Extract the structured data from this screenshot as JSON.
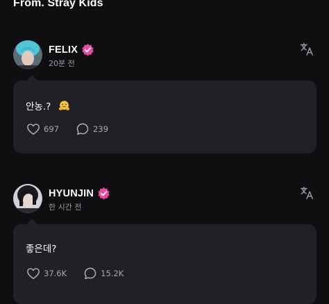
{
  "header": {
    "title": "From. Stray Kids"
  },
  "colors": {
    "background": "#0f0f11",
    "bubble": "#202026",
    "verified": "#e94aa0",
    "muted": "#9a9aa2"
  },
  "posts": [
    {
      "author": "FELIX",
      "verified_icon": "verified-badge-icon",
      "time": "20분 전",
      "message": "안농.?",
      "emoji": "hugging-face-emoji",
      "likes": "697",
      "comments": "239"
    },
    {
      "author": "HYUNJIN",
      "verified_icon": "verified-badge-icon",
      "time": "한 시간 전",
      "message": "좋은데?",
      "likes": "37.6K",
      "comments": "15.2K"
    }
  ]
}
